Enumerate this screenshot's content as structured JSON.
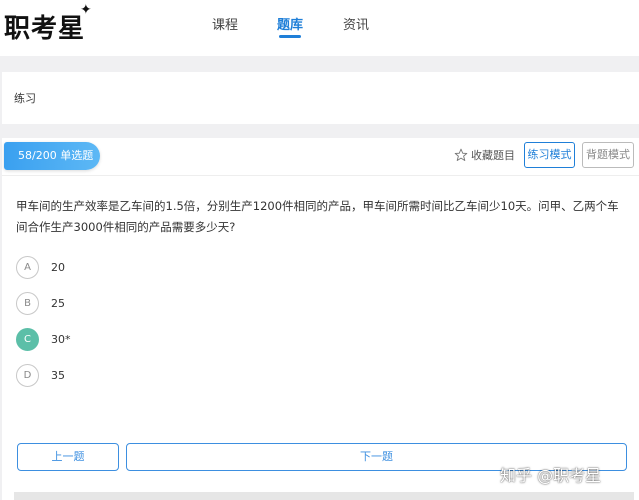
{
  "header": {
    "logo_text": "职考星",
    "nav": [
      "课程",
      "题库",
      "资讯"
    ],
    "active_nav": "题库"
  },
  "breadcrumb": {
    "label": "练习"
  },
  "question_bar": {
    "progress": "58/200 单选题",
    "favorite_label": "收藏题目",
    "practice_mode_label": "练习模式",
    "recite_mode_label": "背题模式"
  },
  "question": {
    "text": "甲车间的生产效率是乙车间的1.5倍，分别生产1200件相同的产品，甲车间所需时间比乙车间少10天。问甲、乙两个车间合作生产3000件相同的产品需要多少天?",
    "options": [
      {
        "letter": "A",
        "text": "20"
      },
      {
        "letter": "B",
        "text": "25"
      },
      {
        "letter": "C",
        "text": "30*"
      },
      {
        "letter": "D",
        "text": "35"
      }
    ],
    "selected": "C"
  },
  "navigation": {
    "prev_label": "上一题",
    "next_label": "下一题"
  },
  "watermark": "知乎 @职考星"
}
